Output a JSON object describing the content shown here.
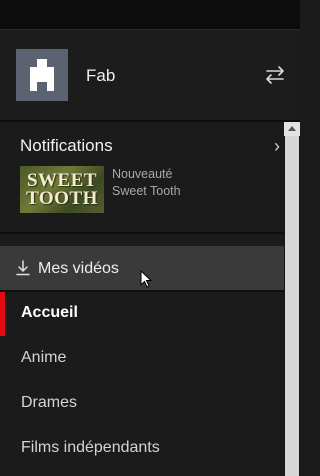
{
  "profile": {
    "name": "Fab"
  },
  "notifications": {
    "title": "Notifications",
    "chevron": "›",
    "item": {
      "thumb_line1": "SWEET",
      "thumb_line2": "TOOTH",
      "kind": "Nouveauté",
      "show": "Sweet Tooth"
    }
  },
  "downloads": {
    "label": "Mes vidéos",
    "icon": "download-icon"
  },
  "nav": {
    "items": [
      {
        "label": "Accueil",
        "active": true
      },
      {
        "label": "Anime"
      },
      {
        "label": "Drames"
      },
      {
        "label": "Films indépendants"
      }
    ]
  },
  "colors": {
    "accent": "#e50914",
    "background": "#1b1b1b",
    "highlight": "#3a3a3a"
  }
}
